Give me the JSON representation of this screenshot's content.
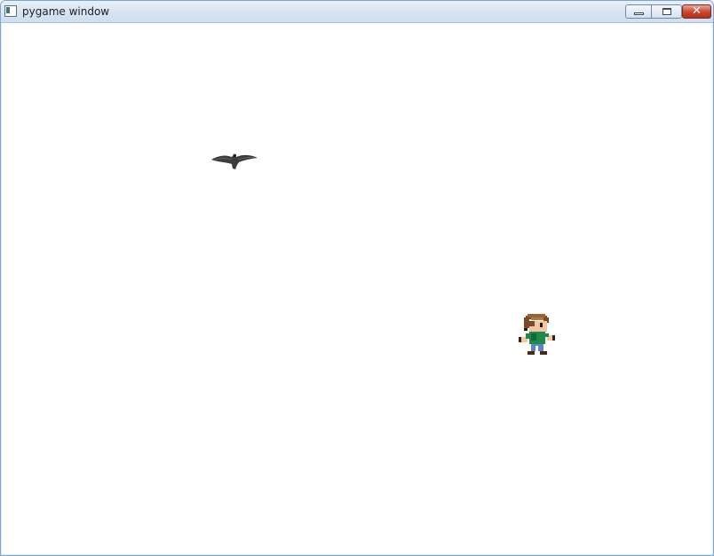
{
  "window": {
    "title": "pygame window",
    "icon": "pygame-app-icon"
  },
  "controls": {
    "minimize_icon": "minimize-icon",
    "maximize_icon": "maximize-icon",
    "close_icon": "close-icon",
    "close_glyph": "✕"
  },
  "scene": {
    "background": "#ffffff",
    "sprites": [
      {
        "kind": "crow",
        "icon": "crow-sprite"
      },
      {
        "kind": "player",
        "icon": "player-sprite"
      }
    ]
  }
}
